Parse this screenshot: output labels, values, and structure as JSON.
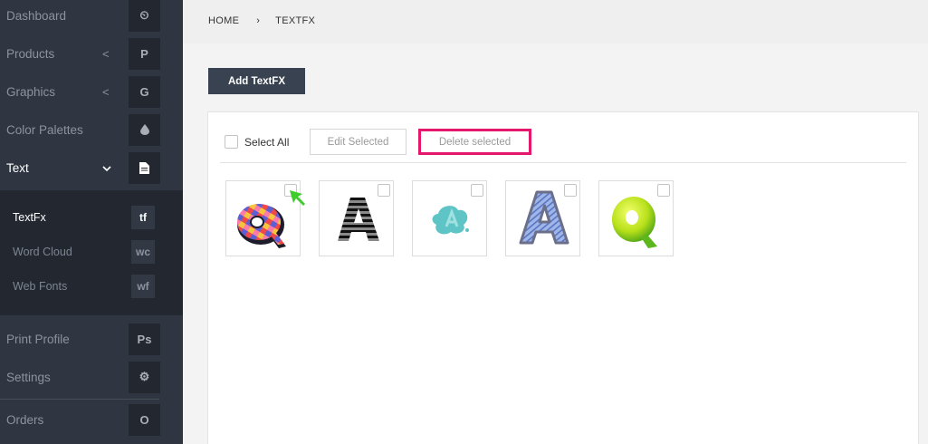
{
  "sidebar": {
    "items": [
      {
        "label": "Dashboard",
        "badge": "⏲",
        "chevron": ""
      },
      {
        "label": "Products",
        "badge": "P",
        "chevron": "<"
      },
      {
        "label": "Graphics",
        "badge": "G",
        "chevron": "<"
      },
      {
        "label": "Color Palettes",
        "badge": "💧",
        "chevron": ""
      },
      {
        "label": "Text",
        "badge": "▤",
        "chevron": "⌄"
      },
      {
        "label": "Print Profile",
        "badge": "Ps",
        "chevron": ""
      },
      {
        "label": "Settings",
        "badge": "⚙",
        "chevron": ""
      },
      {
        "label": "Orders",
        "badge": "O",
        "chevron": ""
      }
    ],
    "submenu": [
      {
        "label": "TextFx",
        "badge": "tf"
      },
      {
        "label": "Word Cloud",
        "badge": "wc"
      },
      {
        "label": "Web Fonts",
        "badge": "wf"
      }
    ]
  },
  "breadcrumb": {
    "home": "HOME",
    "separator": "›",
    "current": "TEXTFX"
  },
  "main": {
    "add_button": "Add TextFX",
    "select_all": "Select All",
    "edit_button": "Edit Selected",
    "delete_button": "Delete selected",
    "thumbnails": [
      {
        "name": "checkered-q-style",
        "icon": "letter-q-checkered-icon"
      },
      {
        "name": "striped-a-style",
        "icon": "letter-a-striped-icon"
      },
      {
        "name": "teal-a-style",
        "icon": "letter-a-teal-icon"
      },
      {
        "name": "sketch-a-style",
        "icon": "letter-a-sketch-icon"
      },
      {
        "name": "green-q-style",
        "icon": "letter-q-green-icon"
      }
    ]
  },
  "colors": {
    "sidebar_bg": "#2f3641",
    "accent_pink": "#e5176d",
    "button_dark": "#384250",
    "pointer_green": "#3ecb2c"
  }
}
